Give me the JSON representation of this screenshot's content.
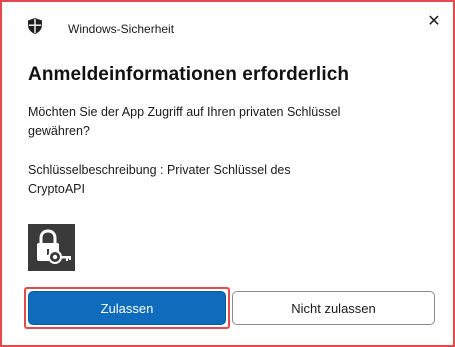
{
  "window": {
    "title": "Windows-Sicherheit",
    "close_symbol": "✕",
    "app_icon": "shield-icon"
  },
  "dialog": {
    "heading": "Anmeldeinformationen erforderlich",
    "message_line1": "Möchten Sie der App Zugriff auf Ihren privaten Schlüssel",
    "message_line2": "gewähren?",
    "description_line1": "Schlüsselbeschreibung  : Privater Schlüssel des",
    "description_line2": "CryptoAPI",
    "credential_icon": "lock-key-icon"
  },
  "buttons": {
    "allow_label": "Zulassen",
    "deny_label": "Nicht zulassen"
  },
  "colors": {
    "accent": "#0f6cbd",
    "highlight": "#e5484d",
    "tile": "#3a3a3a"
  }
}
